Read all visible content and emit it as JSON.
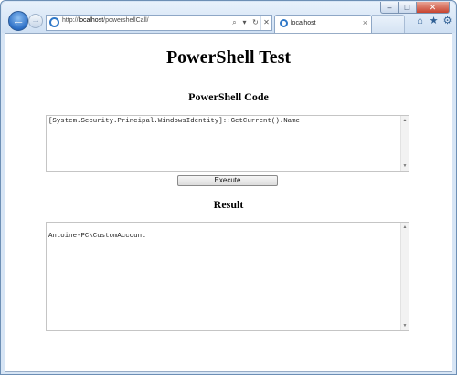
{
  "browser": {
    "url_prefix": "http://",
    "url_host": "localhost",
    "url_path": "/powershellCall/",
    "tab_title": "localhost",
    "nav_back_glyph": "←",
    "nav_forward_glyph": "→",
    "search_glyph": "⌕",
    "dropdown_glyph": "▾",
    "refresh_glyph": "↻",
    "stop_glyph": "✕",
    "tab_close_glyph": "×",
    "home_glyph": "⌂",
    "favorites_glyph": "★",
    "tools_glyph": "⚙",
    "minimize_glyph": "–",
    "maximize_glyph": "□",
    "close_glyph": "✕"
  },
  "page": {
    "title": "PowerShell Test",
    "code_section_title": "PowerShell Code",
    "code_value": "[System.Security.Principal.WindowsIdentity]::GetCurrent().Name",
    "execute_label": "Execute",
    "result_section_title": "Result",
    "result_value": "Antoine-PC\\CustomAccount"
  },
  "icons": {
    "back": "back-arrow-icon",
    "forward": "forward-arrow-icon",
    "page": "ie-page-icon",
    "search": "search-icon",
    "refresh": "refresh-icon",
    "stop": "stop-icon",
    "home": "home-icon",
    "favorites": "star-icon",
    "tools": "gear-icon"
  },
  "colors": {
    "chrome": "#cfe0f3",
    "accent": "#2c6fc6",
    "close_button": "#c7432f"
  }
}
